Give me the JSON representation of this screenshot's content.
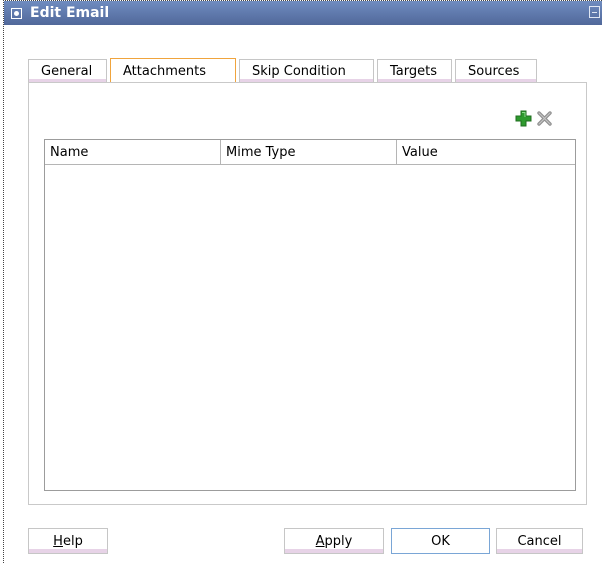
{
  "dialog": {
    "title": "Edit Email",
    "title_bar_color": "#5f79ab"
  },
  "tabs": [
    {
      "label": "General",
      "active": false
    },
    {
      "label": "Attachments",
      "active": true
    },
    {
      "label": "Skip Condition",
      "active": false
    },
    {
      "label": "Targets",
      "active": false
    },
    {
      "label": "Sources",
      "active": false
    }
  ],
  "toolbar": {
    "add_icon": "plus-icon",
    "remove_icon": "delete-x-icon",
    "add_color": "#2e9a2e"
  },
  "table": {
    "columns": [
      "Name",
      "Mime Type",
      "Value"
    ],
    "rows": []
  },
  "buttons": {
    "help": {
      "mnemonic": "H",
      "rest": "elp"
    },
    "apply": {
      "mnemonic": "A",
      "rest": "pply"
    },
    "ok": "OK",
    "cancel": "Cancel"
  }
}
